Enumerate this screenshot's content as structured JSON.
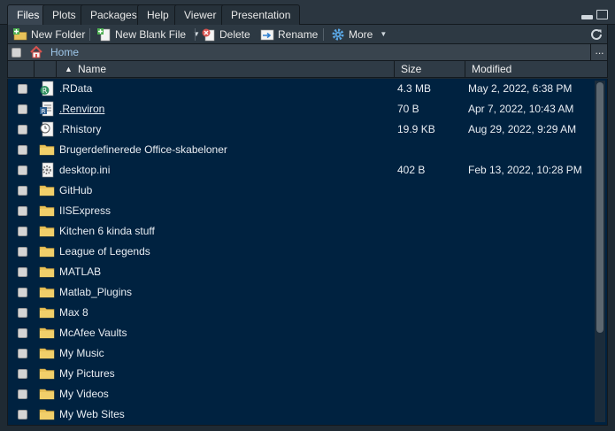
{
  "tabs": [
    {
      "label": "Files",
      "active": true
    },
    {
      "label": "Plots",
      "active": false
    },
    {
      "label": "Packages",
      "active": false
    },
    {
      "label": "Help",
      "active": false
    },
    {
      "label": "Viewer",
      "active": false
    },
    {
      "label": "Presentation",
      "active": false
    }
  ],
  "toolbar": {
    "new_folder": "New Folder",
    "new_blank_file": "New Blank File",
    "delete": "Delete",
    "rename": "Rename",
    "more": "More"
  },
  "path": {
    "home": "Home",
    "more": "..."
  },
  "columns": {
    "name": "Name",
    "size": "Size",
    "modified": "Modified"
  },
  "files": [
    {
      "name": ".RData",
      "size": "4.3 MB",
      "modified": "May 2, 2022, 6:38 PM",
      "icon": "rdata-file-icon",
      "link": false
    },
    {
      "name": ".Renviron",
      "size": "70 B",
      "modified": "Apr 7, 2022, 10:43 AM",
      "icon": "renviron-file-icon",
      "link": true
    },
    {
      "name": ".Rhistory",
      "size": "19.9 KB",
      "modified": "Aug 29, 2022, 9:29 AM",
      "icon": "rhistory-file-icon",
      "link": false
    },
    {
      "name": "Brugerdefinerede Office-skabeloner",
      "size": "",
      "modified": "",
      "icon": "folder-icon",
      "link": false
    },
    {
      "name": "desktop.ini",
      "size": "402 B",
      "modified": "Feb 13, 2022, 10:28 PM",
      "icon": "settings-file-icon",
      "link": false
    },
    {
      "name": "GitHub",
      "size": "",
      "modified": "",
      "icon": "folder-icon",
      "link": false
    },
    {
      "name": "IISExpress",
      "size": "",
      "modified": "",
      "icon": "folder-icon",
      "link": false
    },
    {
      "name": "Kitchen 6 kinda stuff",
      "size": "",
      "modified": "",
      "icon": "folder-icon",
      "link": false
    },
    {
      "name": "League of Legends",
      "size": "",
      "modified": "",
      "icon": "folder-icon",
      "link": false
    },
    {
      "name": "MATLAB",
      "size": "",
      "modified": "",
      "icon": "folder-icon",
      "link": false
    },
    {
      "name": "Matlab_Plugins",
      "size": "",
      "modified": "",
      "icon": "folder-icon",
      "link": false
    },
    {
      "name": "Max 8",
      "size": "",
      "modified": "",
      "icon": "folder-icon",
      "link": false
    },
    {
      "name": "McAfee Vaults",
      "size": "",
      "modified": "",
      "icon": "folder-icon",
      "link": false
    },
    {
      "name": "My Music",
      "size": "",
      "modified": "",
      "icon": "folder-icon",
      "link": false
    },
    {
      "name": "My Pictures",
      "size": "",
      "modified": "",
      "icon": "folder-icon",
      "link": false
    },
    {
      "name": "My Videos",
      "size": "",
      "modified": "",
      "icon": "folder-icon",
      "link": false
    },
    {
      "name": "My Web Sites",
      "size": "",
      "modified": "",
      "icon": "folder-icon",
      "link": false
    }
  ],
  "colors": {
    "list_bg": "#002240",
    "folder": "#e8c25a",
    "accent_green": "#4caf50",
    "delete_red": "#d9534f"
  }
}
